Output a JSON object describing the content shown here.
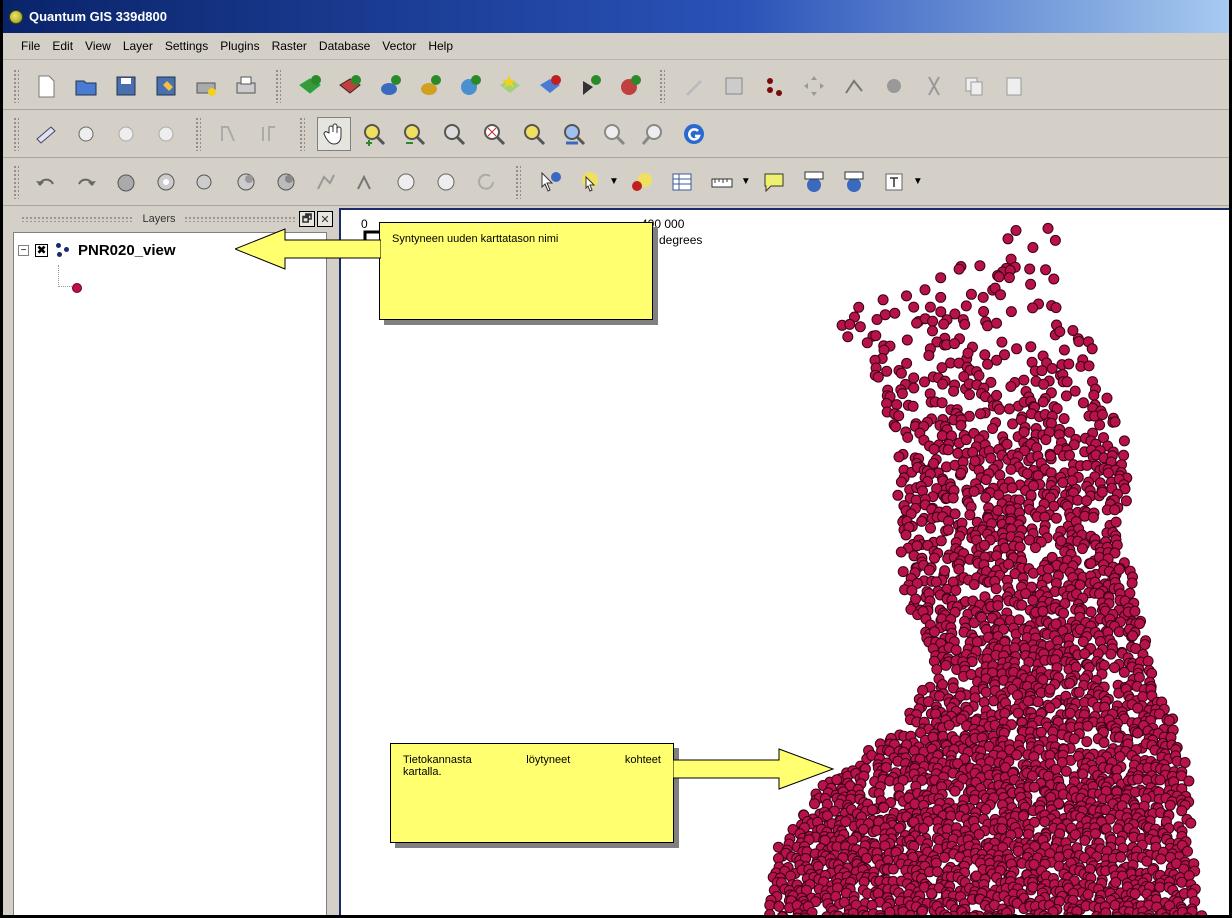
{
  "window": {
    "title": "Quantum GIS 339d800"
  },
  "menu": [
    "File",
    "Edit",
    "View",
    "Layer",
    "Settings",
    "Plugins",
    "Raster",
    "Database",
    "Vector",
    "Help"
  ],
  "layers_panel": {
    "title": "Layers",
    "layer_name": "PNR020_view",
    "layer_checked": "✖"
  },
  "scalebar": {
    "start": "0",
    "end": "400 000",
    "units": "degrees"
  },
  "callouts": {
    "layer_name_note": "Syntyneen uuden karttatason nimi",
    "features_note_words": [
      "Tietokannasta",
      "löytyneet",
      "kohteet"
    ],
    "features_note_line2": "kartalla."
  },
  "colors": {
    "point_fill": "#b8124a",
    "point_stroke": "#3a0018",
    "callout_bg": "#ffff70"
  }
}
